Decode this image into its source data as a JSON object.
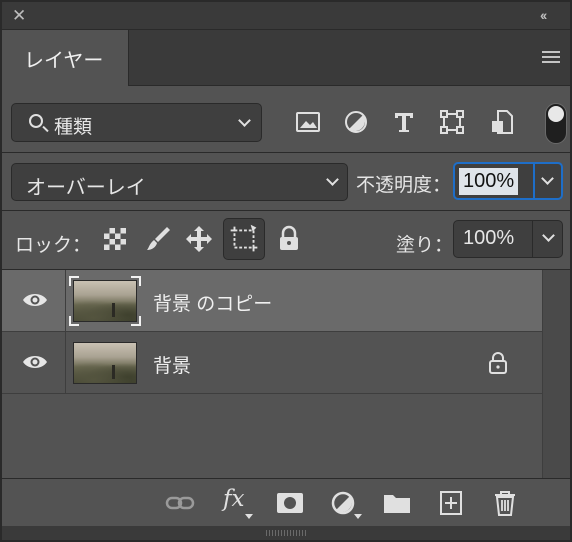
{
  "panel": {
    "close_icon": "close-icon",
    "collapse_icon": "double-chevron-icon"
  },
  "tab": {
    "label": "レイヤー"
  },
  "filter": {
    "label": "種類",
    "icons": [
      "image-icon",
      "adjustment-icon",
      "type-icon",
      "shape-icon",
      "smart-object-icon"
    ]
  },
  "blend": {
    "mode": "オーバーレイ",
    "opacity_label": "不透明度：",
    "opacity_value": "100%"
  },
  "lock": {
    "label": "ロック：",
    "fill_label": "塗り：",
    "fill_value": "100%"
  },
  "layers": [
    {
      "name": "背景 のコピー",
      "visible": true,
      "selected": true,
      "locked": false
    },
    {
      "name": "背景",
      "visible": true,
      "selected": false,
      "locked": true
    }
  ],
  "bottombar": {
    "fx_label": "fx"
  },
  "colors": {
    "accent": "#1e6ec8",
    "panel": "#535353",
    "selected_row": "#6a6a6a"
  }
}
